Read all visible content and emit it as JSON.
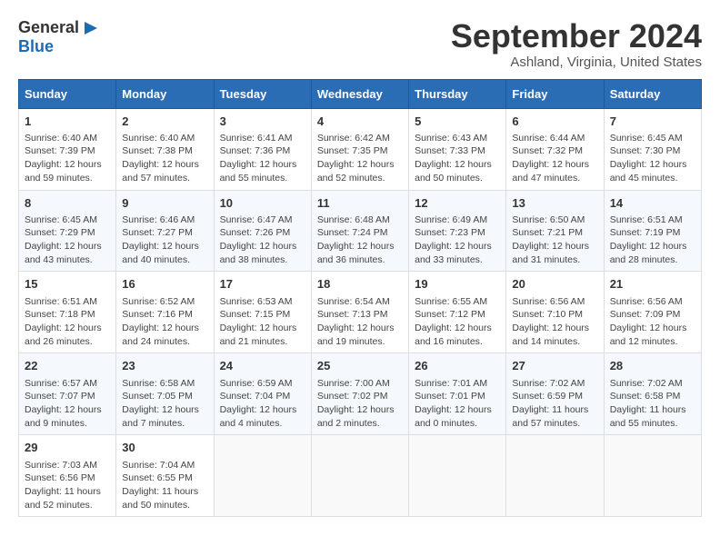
{
  "logo": {
    "line1": "General",
    "line2": "Blue"
  },
  "title": "September 2024",
  "location": "Ashland, Virginia, United States",
  "days_of_week": [
    "Sunday",
    "Monday",
    "Tuesday",
    "Wednesday",
    "Thursday",
    "Friday",
    "Saturday"
  ],
  "weeks": [
    [
      {
        "day": "1",
        "sunrise": "Sunrise: 6:40 AM",
        "sunset": "Sunset: 7:39 PM",
        "daylight": "Daylight: 12 hours and 59 minutes."
      },
      {
        "day": "2",
        "sunrise": "Sunrise: 6:40 AM",
        "sunset": "Sunset: 7:38 PM",
        "daylight": "Daylight: 12 hours and 57 minutes."
      },
      {
        "day": "3",
        "sunrise": "Sunrise: 6:41 AM",
        "sunset": "Sunset: 7:36 PM",
        "daylight": "Daylight: 12 hours and 55 minutes."
      },
      {
        "day": "4",
        "sunrise": "Sunrise: 6:42 AM",
        "sunset": "Sunset: 7:35 PM",
        "daylight": "Daylight: 12 hours and 52 minutes."
      },
      {
        "day": "5",
        "sunrise": "Sunrise: 6:43 AM",
        "sunset": "Sunset: 7:33 PM",
        "daylight": "Daylight: 12 hours and 50 minutes."
      },
      {
        "day": "6",
        "sunrise": "Sunrise: 6:44 AM",
        "sunset": "Sunset: 7:32 PM",
        "daylight": "Daylight: 12 hours and 47 minutes."
      },
      {
        "day": "7",
        "sunrise": "Sunrise: 6:45 AM",
        "sunset": "Sunset: 7:30 PM",
        "daylight": "Daylight: 12 hours and 45 minutes."
      }
    ],
    [
      {
        "day": "8",
        "sunrise": "Sunrise: 6:45 AM",
        "sunset": "Sunset: 7:29 PM",
        "daylight": "Daylight: 12 hours and 43 minutes."
      },
      {
        "day": "9",
        "sunrise": "Sunrise: 6:46 AM",
        "sunset": "Sunset: 7:27 PM",
        "daylight": "Daylight: 12 hours and 40 minutes."
      },
      {
        "day": "10",
        "sunrise": "Sunrise: 6:47 AM",
        "sunset": "Sunset: 7:26 PM",
        "daylight": "Daylight: 12 hours and 38 minutes."
      },
      {
        "day": "11",
        "sunrise": "Sunrise: 6:48 AM",
        "sunset": "Sunset: 7:24 PM",
        "daylight": "Daylight: 12 hours and 36 minutes."
      },
      {
        "day": "12",
        "sunrise": "Sunrise: 6:49 AM",
        "sunset": "Sunset: 7:23 PM",
        "daylight": "Daylight: 12 hours and 33 minutes."
      },
      {
        "day": "13",
        "sunrise": "Sunrise: 6:50 AM",
        "sunset": "Sunset: 7:21 PM",
        "daylight": "Daylight: 12 hours and 31 minutes."
      },
      {
        "day": "14",
        "sunrise": "Sunrise: 6:51 AM",
        "sunset": "Sunset: 7:19 PM",
        "daylight": "Daylight: 12 hours and 28 minutes."
      }
    ],
    [
      {
        "day": "15",
        "sunrise": "Sunrise: 6:51 AM",
        "sunset": "Sunset: 7:18 PM",
        "daylight": "Daylight: 12 hours and 26 minutes."
      },
      {
        "day": "16",
        "sunrise": "Sunrise: 6:52 AM",
        "sunset": "Sunset: 7:16 PM",
        "daylight": "Daylight: 12 hours and 24 minutes."
      },
      {
        "day": "17",
        "sunrise": "Sunrise: 6:53 AM",
        "sunset": "Sunset: 7:15 PM",
        "daylight": "Daylight: 12 hours and 21 minutes."
      },
      {
        "day": "18",
        "sunrise": "Sunrise: 6:54 AM",
        "sunset": "Sunset: 7:13 PM",
        "daylight": "Daylight: 12 hours and 19 minutes."
      },
      {
        "day": "19",
        "sunrise": "Sunrise: 6:55 AM",
        "sunset": "Sunset: 7:12 PM",
        "daylight": "Daylight: 12 hours and 16 minutes."
      },
      {
        "day": "20",
        "sunrise": "Sunrise: 6:56 AM",
        "sunset": "Sunset: 7:10 PM",
        "daylight": "Daylight: 12 hours and 14 minutes."
      },
      {
        "day": "21",
        "sunrise": "Sunrise: 6:56 AM",
        "sunset": "Sunset: 7:09 PM",
        "daylight": "Daylight: 12 hours and 12 minutes."
      }
    ],
    [
      {
        "day": "22",
        "sunrise": "Sunrise: 6:57 AM",
        "sunset": "Sunset: 7:07 PM",
        "daylight": "Daylight: 12 hours and 9 minutes."
      },
      {
        "day": "23",
        "sunrise": "Sunrise: 6:58 AM",
        "sunset": "Sunset: 7:05 PM",
        "daylight": "Daylight: 12 hours and 7 minutes."
      },
      {
        "day": "24",
        "sunrise": "Sunrise: 6:59 AM",
        "sunset": "Sunset: 7:04 PM",
        "daylight": "Daylight: 12 hours and 4 minutes."
      },
      {
        "day": "25",
        "sunrise": "Sunrise: 7:00 AM",
        "sunset": "Sunset: 7:02 PM",
        "daylight": "Daylight: 12 hours and 2 minutes."
      },
      {
        "day": "26",
        "sunrise": "Sunrise: 7:01 AM",
        "sunset": "Sunset: 7:01 PM",
        "daylight": "Daylight: 12 hours and 0 minutes."
      },
      {
        "day": "27",
        "sunrise": "Sunrise: 7:02 AM",
        "sunset": "Sunset: 6:59 PM",
        "daylight": "Daylight: 11 hours and 57 minutes."
      },
      {
        "day": "28",
        "sunrise": "Sunrise: 7:02 AM",
        "sunset": "Sunset: 6:58 PM",
        "daylight": "Daylight: 11 hours and 55 minutes."
      }
    ],
    [
      {
        "day": "29",
        "sunrise": "Sunrise: 7:03 AM",
        "sunset": "Sunset: 6:56 PM",
        "daylight": "Daylight: 11 hours and 52 minutes."
      },
      {
        "day": "30",
        "sunrise": "Sunrise: 7:04 AM",
        "sunset": "Sunset: 6:55 PM",
        "daylight": "Daylight: 11 hours and 50 minutes."
      },
      null,
      null,
      null,
      null,
      null
    ]
  ]
}
